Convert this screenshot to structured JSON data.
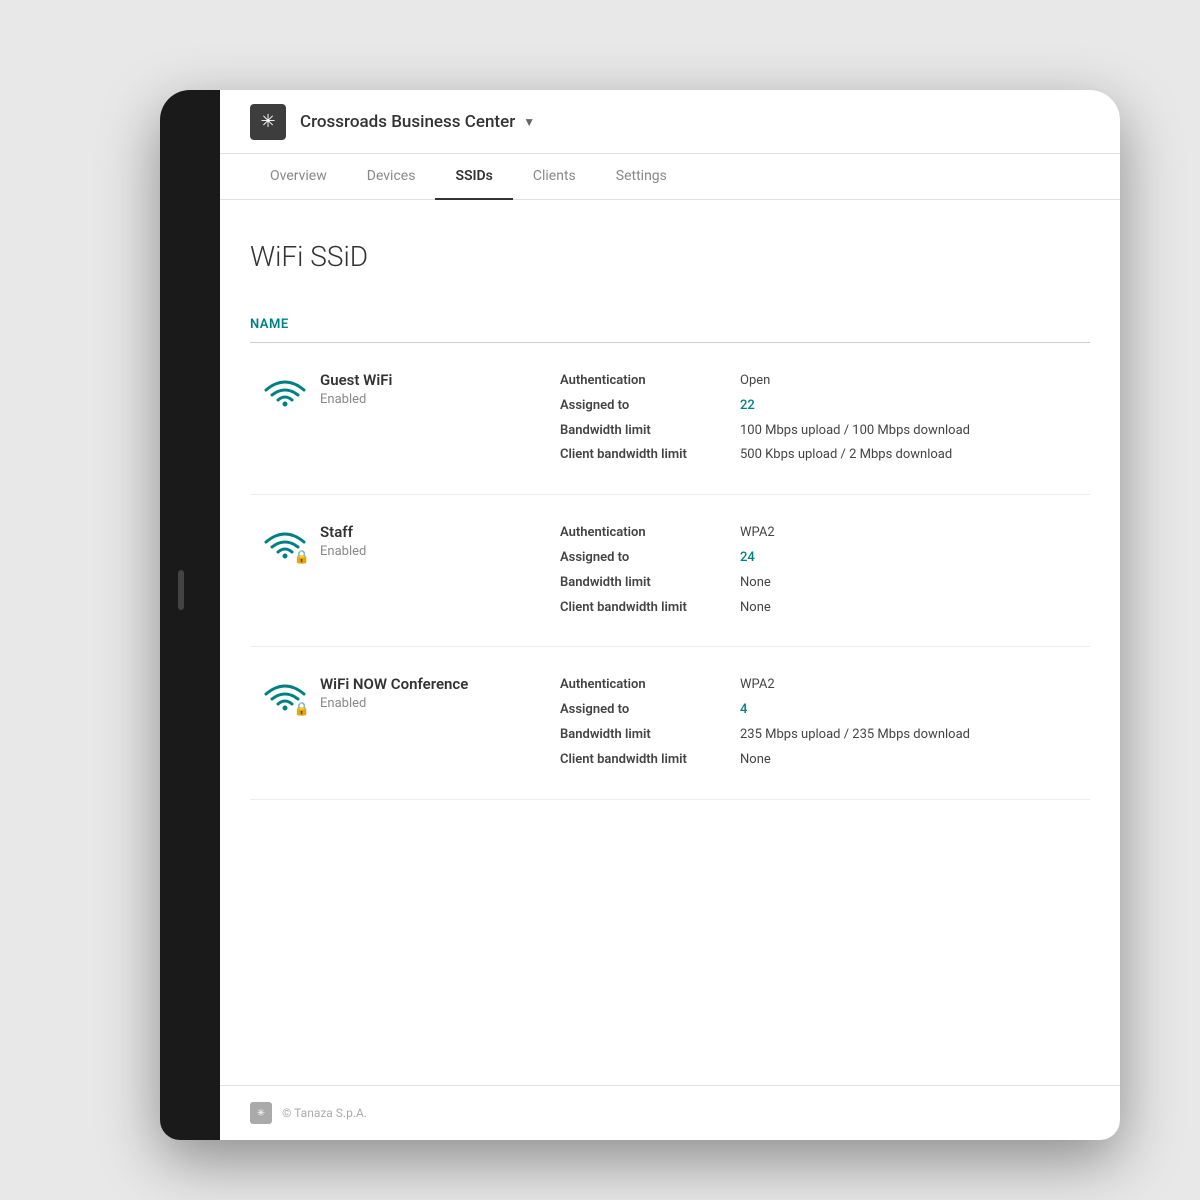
{
  "header": {
    "org_name": "Crossroads Business Center",
    "dropdown_label": "▼"
  },
  "nav": {
    "tabs": [
      {
        "label": "Overview",
        "active": false
      },
      {
        "label": "Devices",
        "active": false
      },
      {
        "label": "SSIDs",
        "active": true
      },
      {
        "label": "Clients",
        "active": false
      },
      {
        "label": "Settings",
        "active": false
      }
    ]
  },
  "page": {
    "title": "WiFi SSiD",
    "table_header": "Name"
  },
  "ssids": [
    {
      "name": "Guest WiFi",
      "status": "Enabled",
      "has_lock": false,
      "authentication_label": "Authentication",
      "authentication_value": "Open",
      "assigned_to_label": "Assigned to",
      "assigned_to_value": "22",
      "bandwidth_label": "Bandwidth limit",
      "bandwidth_value": "100 Mbps upload / 100 Mbps download",
      "client_bw_label": "Client bandwidth limit",
      "client_bw_value": "500 Kbps upload / 2 Mbps download"
    },
    {
      "name": "Staff",
      "status": "Enabled",
      "has_lock": true,
      "authentication_label": "Authentication",
      "authentication_value": "WPA2",
      "assigned_to_label": "Assigned to",
      "assigned_to_value": "24",
      "bandwidth_label": "Bandwidth limit",
      "bandwidth_value": "None",
      "client_bw_label": "Client bandwidth limit",
      "client_bw_value": "None"
    },
    {
      "name": "WiFi NOW Conference",
      "status": "Enabled",
      "has_lock": true,
      "authentication_label": "Authentication",
      "authentication_value": "WPA2",
      "assigned_to_label": "Assigned to",
      "assigned_to_value": "4",
      "bandwidth_label": "Bandwidth limit",
      "bandwidth_value": "235 Mbps upload / 235 Mbps download",
      "client_bw_label": "Client bandwidth limit",
      "client_bw_value": "None"
    }
  ],
  "footer": {
    "copyright": "© Tanaza S.p.A."
  }
}
